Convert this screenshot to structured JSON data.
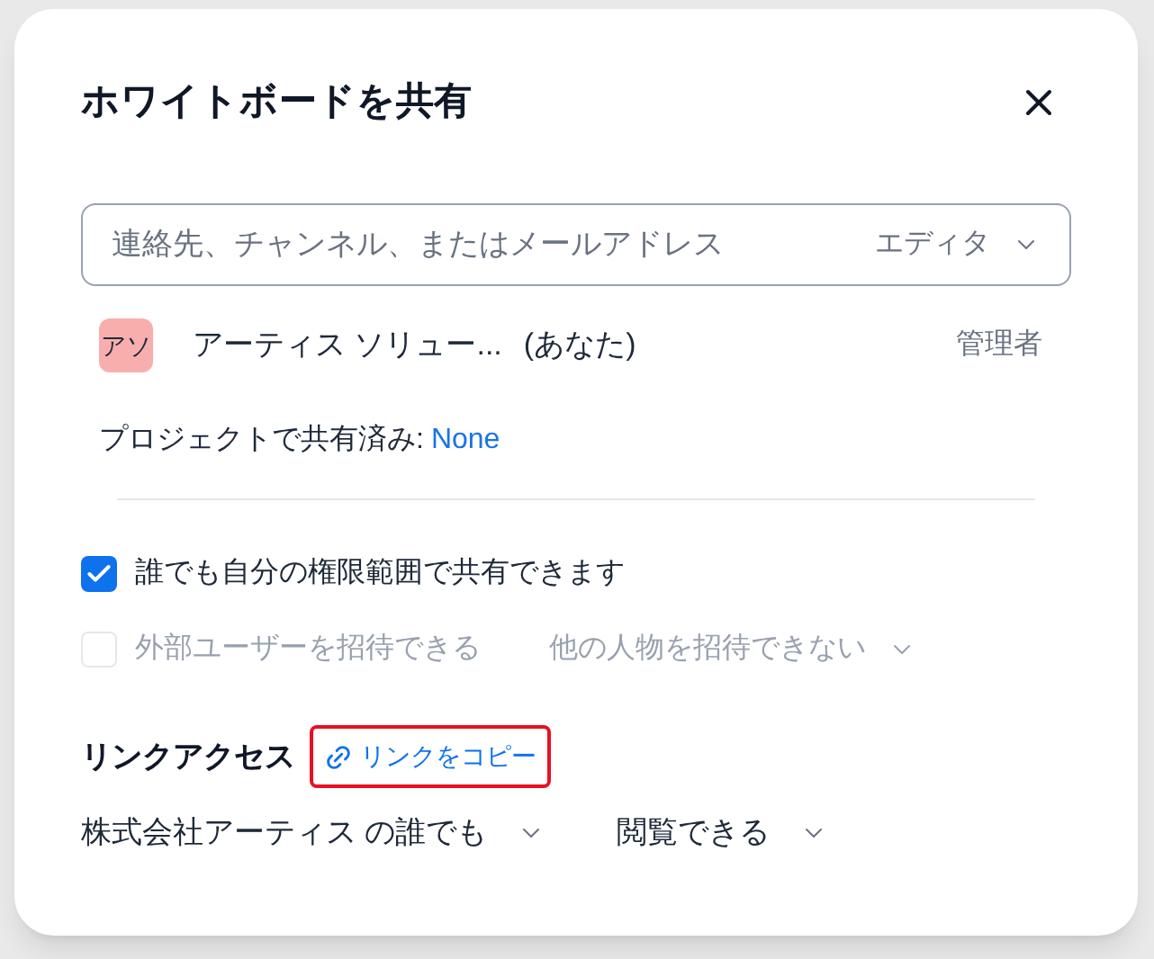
{
  "dialog": {
    "title": "ホワイトボードを共有"
  },
  "invite_field": {
    "placeholder": "連絡先、チャンネル、またはメールアドレス",
    "role": "エディタ"
  },
  "members": [
    {
      "initials": "アソ",
      "color": "#f9aeae",
      "name": "アーティス ソリュー...",
      "suffix": "(あなた)",
      "role": "管理者"
    }
  ],
  "project_share": {
    "label": "プロジェクトで共有済み:",
    "value": "None"
  },
  "options": [
    {
      "label": "誰でも自分の権限範囲で共有できます",
      "checked": true,
      "disabled": false
    },
    {
      "label": "外部ユーザーを招待できる",
      "checked": false,
      "disabled": true,
      "dropdown": "他の人物を招待できない"
    }
  ],
  "link_access": {
    "title": "リンクアクセス",
    "copy_link": {
      "label": "リンクをコピー",
      "highlighted": true
    },
    "scope": "株式会社アーティス の誰でも",
    "permission": "閲覧できる"
  }
}
